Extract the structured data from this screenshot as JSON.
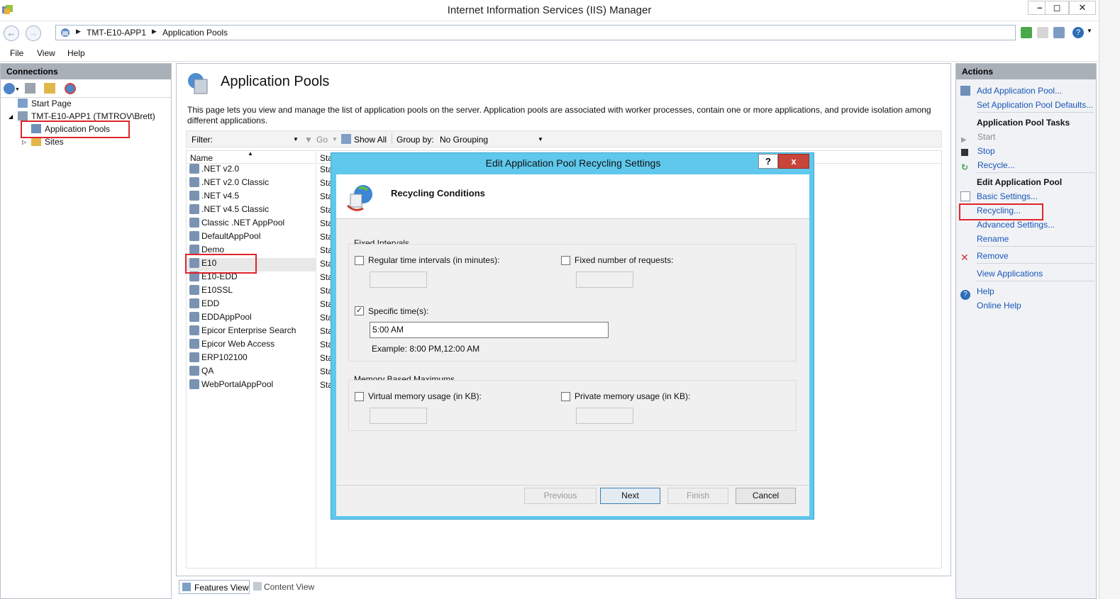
{
  "window": {
    "title": "Internet Information Services (IIS) Manager",
    "controls": [
      "minimize",
      "maximize",
      "close"
    ]
  },
  "address": {
    "crumbs": [
      "TMT-E10-APP1",
      "Application Pools"
    ]
  },
  "menu": [
    "File",
    "View",
    "Help"
  ],
  "connections": {
    "header": "Connections",
    "tree": [
      {
        "label": "Start Page",
        "icon": "start-page-icon"
      },
      {
        "label": "TMT-E10-APP1 (TMTROV\\Brett)",
        "icon": "server-icon"
      },
      {
        "label": "Application Pools",
        "icon": "app-pools-icon",
        "selected": true
      },
      {
        "label": "Sites",
        "icon": "sites-icon"
      }
    ]
  },
  "center": {
    "title": "Application Pools",
    "description": "This page lets you view and manage the list of application pools on the server. Application pools are associated with worker processes, contain one or more applications, and provide isolation among different applications.",
    "filter_label": "Filter:",
    "go_label": "Go",
    "show_all_label": "Show All",
    "group_by_label": "Group by:",
    "group_by_value": "No Grouping",
    "columns": [
      "Name",
      "Sta"
    ],
    "pools": [
      {
        "name": ".NET v2.0",
        "status": "Sta"
      },
      {
        "name": ".NET v2.0 Classic",
        "status": "Sta"
      },
      {
        "name": ".NET v4.5",
        "status": "Sta"
      },
      {
        "name": ".NET v4.5 Classic",
        "status": "Sta"
      },
      {
        "name": "Classic .NET AppPool",
        "status": "Sta"
      },
      {
        "name": "DefaultAppPool",
        "status": "Sta"
      },
      {
        "name": "Demo",
        "status": "Sta"
      },
      {
        "name": "E10",
        "status": "Sta",
        "selected": true
      },
      {
        "name": "E10-EDD",
        "status": "Sta"
      },
      {
        "name": "E10SSL",
        "status": "Sta"
      },
      {
        "name": "EDD",
        "status": "Sta"
      },
      {
        "name": "EDDAppPool",
        "status": "Sta"
      },
      {
        "name": "Epicor Enterprise Search",
        "status": "Sta"
      },
      {
        "name": "Epicor Web Access",
        "status": "Sta"
      },
      {
        "name": "ERP102100",
        "status": "Sta"
      },
      {
        "name": "QA",
        "status": "Sta"
      },
      {
        "name": "WebPortalAppPool",
        "status": "Sta"
      }
    ],
    "tabs": [
      "Features View",
      "Content View"
    ]
  },
  "actions": {
    "header": "Actions",
    "add_pool": "Add Application Pool...",
    "set_defaults": "Set Application Pool Defaults...",
    "tasks_heading": "Application Pool Tasks",
    "start": "Start",
    "stop": "Stop",
    "recycle": "Recycle...",
    "edit_heading": "Edit Application Pool",
    "basic_settings": "Basic Settings...",
    "recycling": "Recycling...",
    "advanced_settings": "Advanced Settings...",
    "rename": "Rename",
    "remove": "Remove",
    "view_applications": "View Applications",
    "help": "Help",
    "online_help": "Online Help"
  },
  "dialog": {
    "title": "Edit Application Pool Recycling Settings",
    "help_btn": "?",
    "close_btn": "x",
    "heading": "Recycling Conditions",
    "fixed_group": "Fixed Intervals",
    "regular_time": "Regular time intervals (in minutes):",
    "fixed_requests": "Fixed number of requests:",
    "specific_times": "Specific time(s):",
    "specific_times_value": "5:00 AM",
    "example": "Example: 8:00 PM,12:00 AM",
    "memory_group": "Memory Based Maximums",
    "virtual_memory": "Virtual memory usage (in KB):",
    "private_memory": "Private memory usage (in KB):",
    "buttons": {
      "previous": "Previous",
      "next": "Next",
      "finish": "Finish",
      "cancel": "Cancel"
    },
    "checked": {
      "regular_time": false,
      "fixed_requests": false,
      "specific_times": true,
      "virtual_memory": false,
      "private_memory": false
    }
  },
  "colors": {
    "dialog_frame": "#5fc8ec",
    "close_red": "#c7453a",
    "link_blue": "#1a55b8",
    "annotation_red": "#e0242a"
  }
}
